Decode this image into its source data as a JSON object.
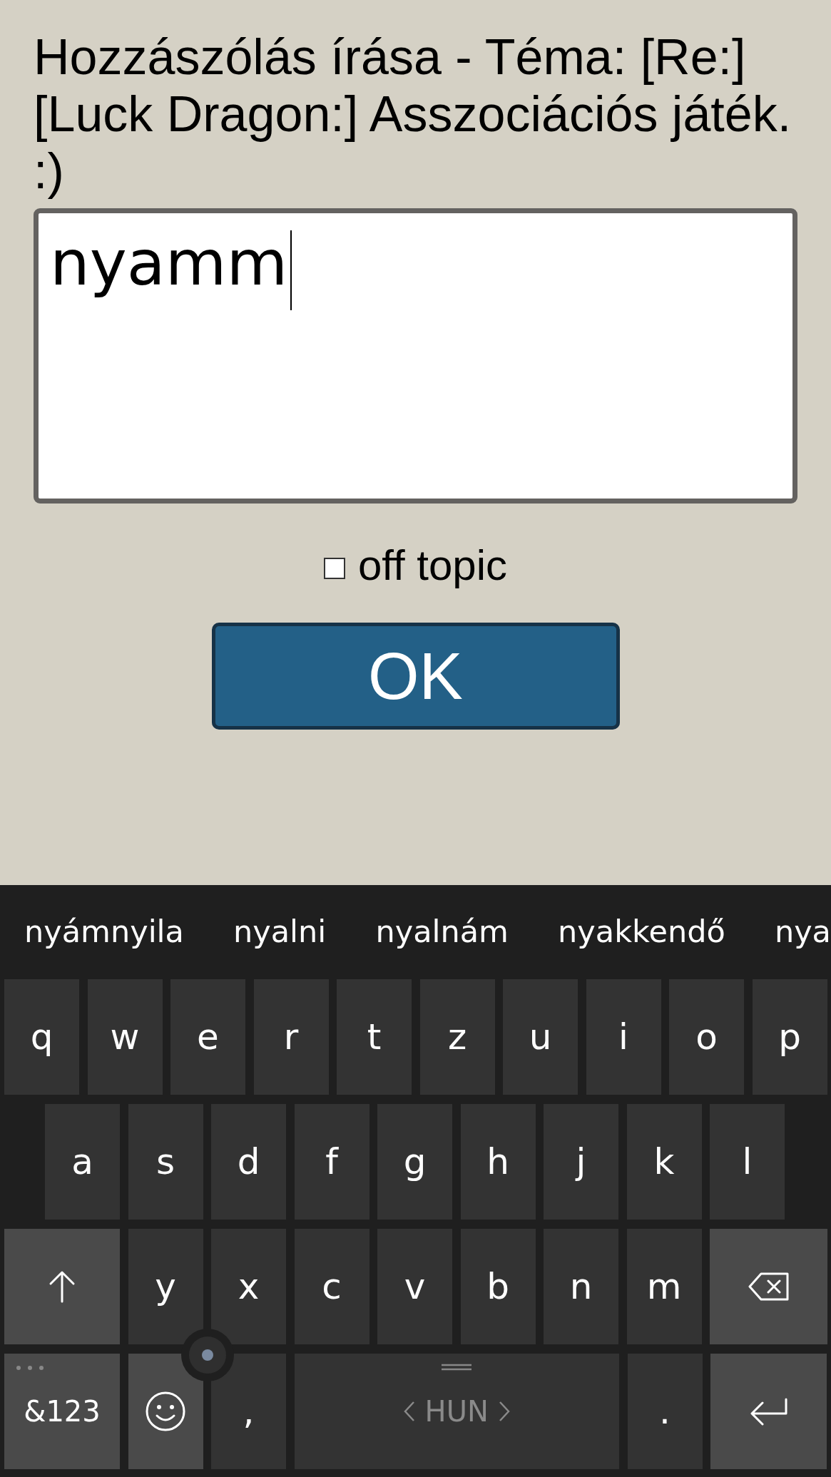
{
  "heading": "Hozzászólás írása - Téma: [Re:] [Luck Dragon:] Asszociációs játék. :)",
  "message": {
    "value": "nyamm"
  },
  "off_topic": {
    "label": "off topic",
    "checked": false
  },
  "submit": {
    "label": "OK"
  },
  "keyboard": {
    "suggestions": [
      "nyámnyila",
      "nyalni",
      "nyalnám",
      "nyakkendő",
      "nya"
    ],
    "rows": [
      [
        {
          "kind": "letter",
          "label": "q"
        },
        {
          "kind": "letter",
          "label": "w"
        },
        {
          "kind": "letter",
          "label": "e"
        },
        {
          "kind": "letter",
          "label": "r"
        },
        {
          "kind": "letter",
          "label": "t"
        },
        {
          "kind": "letter",
          "label": "z"
        },
        {
          "kind": "letter",
          "label": "u"
        },
        {
          "kind": "letter",
          "label": "i"
        },
        {
          "kind": "letter",
          "label": "o"
        },
        {
          "kind": "letter",
          "label": "p"
        }
      ],
      [
        {
          "kind": "letter",
          "label": "a"
        },
        {
          "kind": "letter",
          "label": "s"
        },
        {
          "kind": "letter",
          "label": "d"
        },
        {
          "kind": "letter",
          "label": "f"
        },
        {
          "kind": "letter",
          "label": "g"
        },
        {
          "kind": "letter",
          "label": "h"
        },
        {
          "kind": "letter",
          "label": "j"
        },
        {
          "kind": "letter",
          "label": "k"
        },
        {
          "kind": "letter",
          "label": "l"
        }
      ],
      [
        {
          "kind": "shift"
        },
        {
          "kind": "letter",
          "label": "y"
        },
        {
          "kind": "letter",
          "label": "x"
        },
        {
          "kind": "letter",
          "label": "c"
        },
        {
          "kind": "letter",
          "label": "v"
        },
        {
          "kind": "letter",
          "label": "b"
        },
        {
          "kind": "letter",
          "label": "n"
        },
        {
          "kind": "letter",
          "label": "m"
        },
        {
          "kind": "backspace"
        }
      ]
    ],
    "bottom_bar": [
      {
        "kind": "symbols",
        "label": "&123"
      },
      {
        "kind": "emoji"
      },
      {
        "kind": "letter",
        "label": ","
      },
      {
        "kind": "space",
        "label": "HUN"
      },
      {
        "kind": "letter",
        "label": "."
      },
      {
        "kind": "enter"
      }
    ]
  }
}
